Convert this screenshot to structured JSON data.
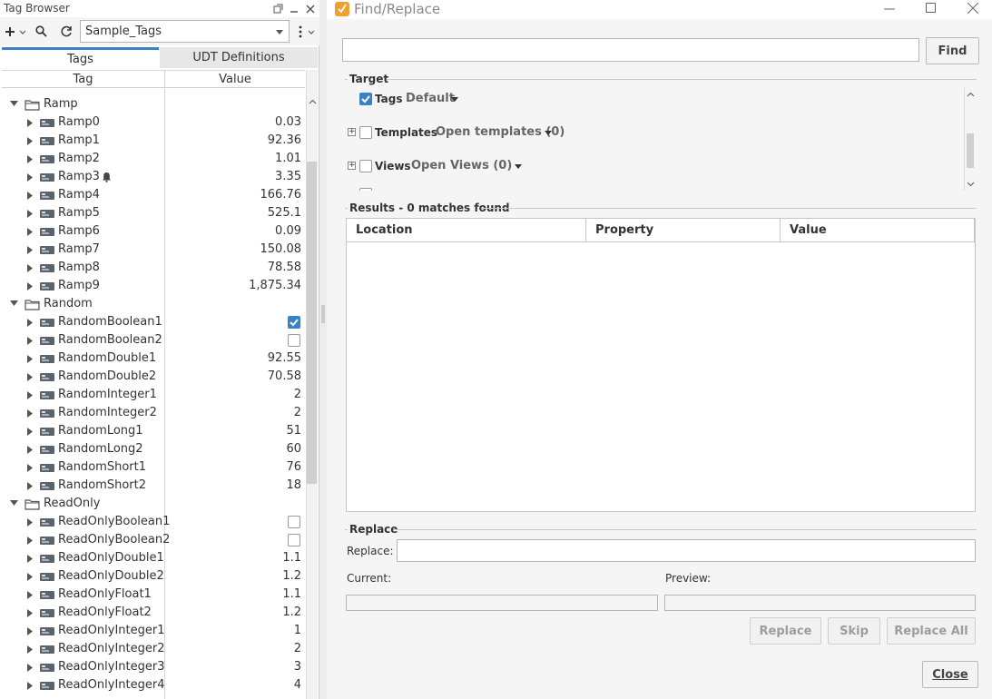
{
  "tag_browser": {
    "title": "Tag Browser",
    "provider": "Sample_Tags",
    "tabs": [
      "Tags",
      "UDT Definitions"
    ],
    "columns": [
      "Tag",
      "Value"
    ],
    "rows": [
      {
        "kind": "folder",
        "label": "Ramp",
        "value": ""
      },
      {
        "kind": "tag",
        "label": "Ramp0",
        "value": "0.03"
      },
      {
        "kind": "tag",
        "label": "Ramp1",
        "value": "92.36"
      },
      {
        "kind": "tag",
        "label": "Ramp2",
        "value": "1.01"
      },
      {
        "kind": "tag",
        "label": "Ramp3",
        "value": "3.35",
        "alarm": true
      },
      {
        "kind": "tag",
        "label": "Ramp4",
        "value": "166.76"
      },
      {
        "kind": "tag",
        "label": "Ramp5",
        "value": "525.1"
      },
      {
        "kind": "tag",
        "label": "Ramp6",
        "value": "0.09"
      },
      {
        "kind": "tag",
        "label": "Ramp7",
        "value": "150.08"
      },
      {
        "kind": "tag",
        "label": "Ramp8",
        "value": "78.58"
      },
      {
        "kind": "tag",
        "label": "Ramp9",
        "value": "1,875.34"
      },
      {
        "kind": "folder",
        "label": "Random",
        "value": ""
      },
      {
        "kind": "tag",
        "label": "RandomBoolean1",
        "checkbox": true,
        "checked": true
      },
      {
        "kind": "tag",
        "label": "RandomBoolean2",
        "checkbox": true,
        "checked": false
      },
      {
        "kind": "tag",
        "label": "RandomDouble1",
        "value": "92.55"
      },
      {
        "kind": "tag",
        "label": "RandomDouble2",
        "value": "70.58"
      },
      {
        "kind": "tag",
        "label": "RandomInteger1",
        "value": "2"
      },
      {
        "kind": "tag",
        "label": "RandomInteger2",
        "value": "2"
      },
      {
        "kind": "tag",
        "label": "RandomLong1",
        "value": "51"
      },
      {
        "kind": "tag",
        "label": "RandomLong2",
        "value": "60"
      },
      {
        "kind": "tag",
        "label": "RandomShort1",
        "value": "76"
      },
      {
        "kind": "tag",
        "label": "RandomShort2",
        "value": "18"
      },
      {
        "kind": "folder",
        "label": "ReadOnly",
        "value": ""
      },
      {
        "kind": "tag",
        "label": "ReadOnlyBoolean1",
        "checkbox": true,
        "checked": false
      },
      {
        "kind": "tag",
        "label": "ReadOnlyBoolean2",
        "checkbox": true,
        "checked": false
      },
      {
        "kind": "tag",
        "label": "ReadOnlyDouble1",
        "value": "1.1"
      },
      {
        "kind": "tag",
        "label": "ReadOnlyDouble2",
        "value": "1.2"
      },
      {
        "kind": "tag",
        "label": "ReadOnlyFloat1",
        "value": "1.1"
      },
      {
        "kind": "tag",
        "label": "ReadOnlyFloat2",
        "value": "1.2"
      },
      {
        "kind": "tag",
        "label": "ReadOnlyInteger1",
        "value": "1"
      },
      {
        "kind": "tag",
        "label": "ReadOnlyInteger2",
        "value": "2"
      },
      {
        "kind": "tag",
        "label": "ReadOnlyInteger3",
        "value": "3"
      },
      {
        "kind": "tag",
        "label": "ReadOnlyInteger4",
        "value": "4"
      }
    ]
  },
  "find_replace": {
    "title": "Find/Replace",
    "find_value": "",
    "find_button": "Find",
    "target_label": "Target",
    "target": {
      "tags_label": "Tags",
      "tags_checked": true,
      "tags_dropdown": "Default",
      "templates_label": "Templates",
      "templates_checked": false,
      "templates_dropdown": "Open templates (0)",
      "views_label": "Views",
      "views_checked": false,
      "views_dropdown": "Open Views (0)"
    },
    "results_label": "Results - 0 matches found",
    "results_columns": [
      "Location",
      "Property",
      "Value"
    ],
    "replace_section": "Replace",
    "replace_label": "Replace:",
    "replace_value": "",
    "current_label": "Current:",
    "preview_label": "Preview:",
    "buttons": {
      "replace": "Replace",
      "skip": "Skip",
      "replace_all": "Replace All",
      "close": "Close"
    }
  },
  "colors": {
    "accent": "#3b82c4",
    "title_icon": "#f0a030"
  }
}
